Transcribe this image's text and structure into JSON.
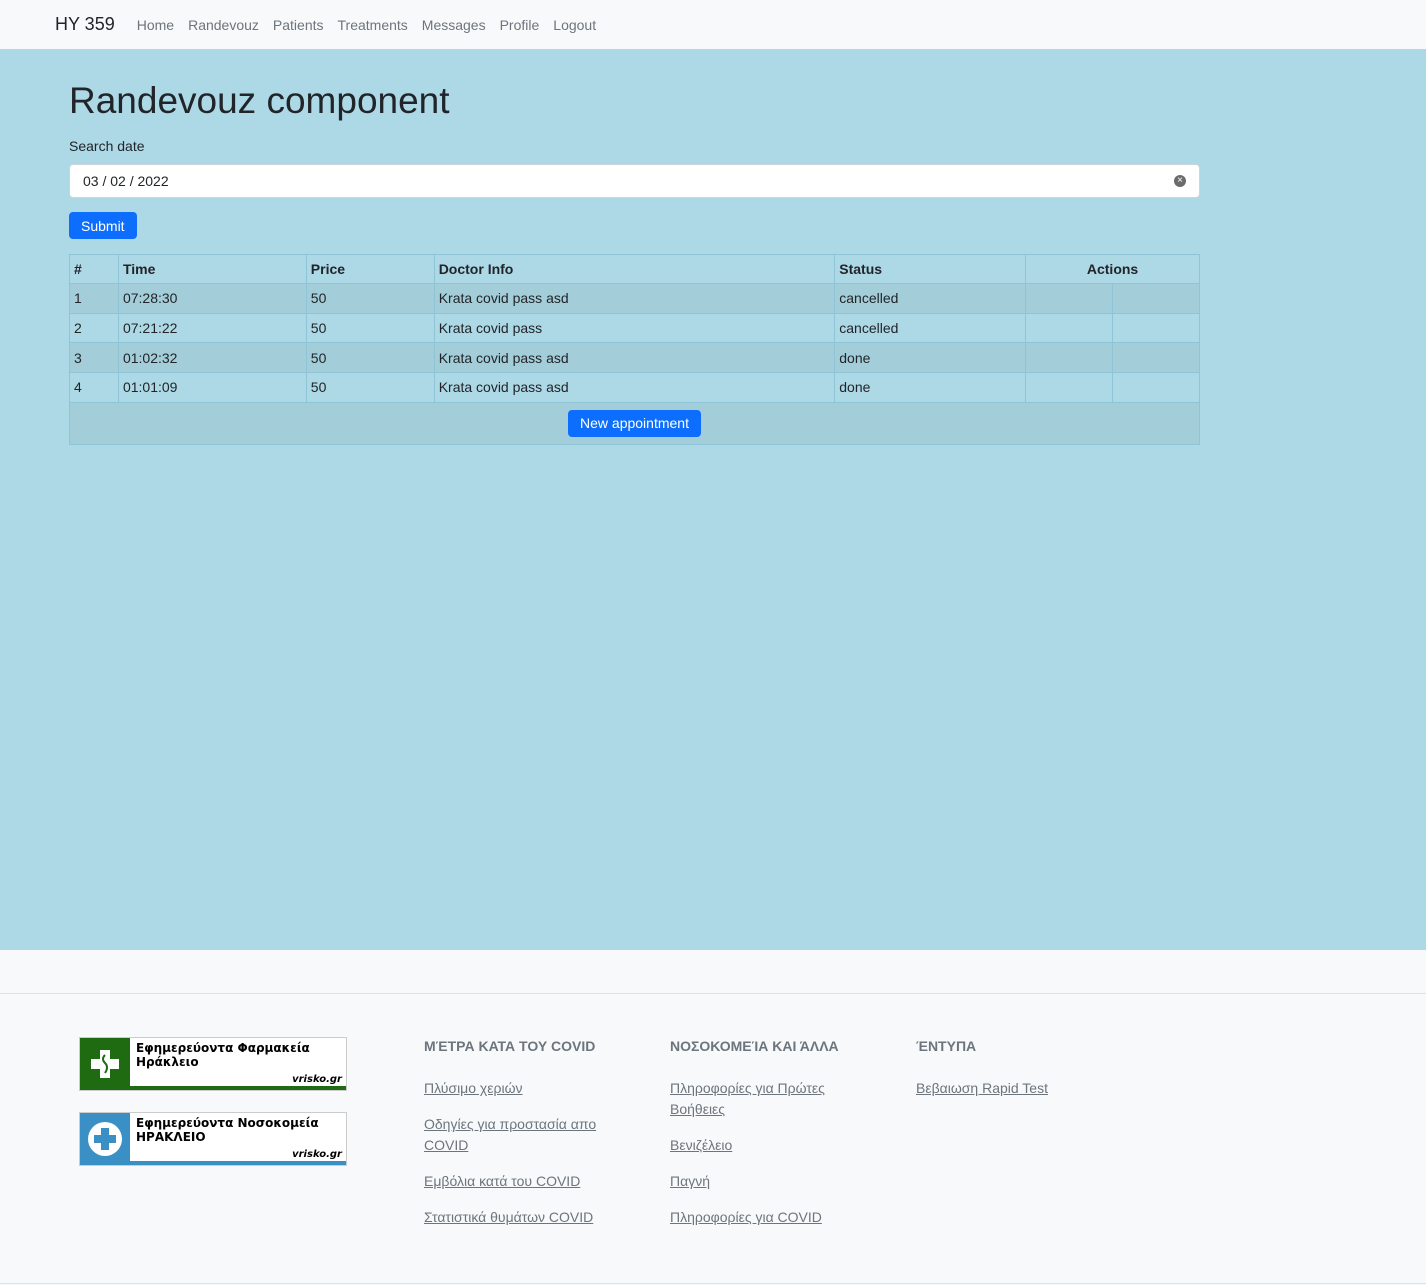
{
  "navbar": {
    "brand": "HY 359",
    "links": [
      "Home",
      "Randevouz",
      "Patients",
      "Treatments",
      "Messages",
      "Profile",
      "Logout"
    ]
  },
  "page": {
    "title": "Randevouz component",
    "search_label": "Search date",
    "date_value": "03 / 02 / 2022",
    "submit_label": "Submit"
  },
  "table": {
    "headers": [
      "#",
      "Time",
      "Price",
      "Doctor Info",
      "Status",
      "Actions"
    ],
    "rows": [
      {
        "num": "1",
        "time": "07:28:30",
        "price": "50",
        "doctor": "Krata covid pass asd",
        "status": "cancelled"
      },
      {
        "num": "2",
        "time": "07:21:22",
        "price": "50",
        "doctor": "Krata covid pass",
        "status": "cancelled"
      },
      {
        "num": "3",
        "time": "01:02:32",
        "price": "50",
        "doctor": "Krata covid pass asd",
        "status": "done"
      },
      {
        "num": "4",
        "time": "01:01:09",
        "price": "50",
        "doctor": "Krata covid pass asd",
        "status": "done"
      }
    ],
    "new_appointment_label": "New appointment"
  },
  "footer": {
    "banners": [
      {
        "line1": "Εφημερεύοντα Φαρμακεία",
        "line2": "Ηράκλειο",
        "brand": "vrisko.gr",
        "color": "#1e6b12"
      },
      {
        "line1": "Εφημερεύοντα Νοσοκομεία",
        "line2": "ΗΡΑΚΛΕΙΟ",
        "brand": "vrisko.gr",
        "color": "#3a8fc4"
      }
    ],
    "columns": [
      {
        "heading": "ΜΈΤΡΑ ΚΑΤΑ ΤΟΥ COVID",
        "links": [
          "Πλύσιμο χεριών",
          "Οδηγίες για προστασία απο COVID",
          "Εμβόλια κατά του COVID",
          "Στατιστικά θυμάτων COVID"
        ]
      },
      {
        "heading": "ΝΟΣΟΚΟΜΕΊΑ ΚΑΙ ΆΛΛΑ",
        "links": [
          "Πληροφορίες για Πρώτες Βοήθειες",
          "Βενιζέλειο",
          "Παγνή",
          "Πληροφορίες για COVID"
        ]
      },
      {
        "heading": "ΈΝΤΥΠΑ",
        "links": [
          "Βεβαιωση Rapid Test"
        ]
      }
    ]
  }
}
